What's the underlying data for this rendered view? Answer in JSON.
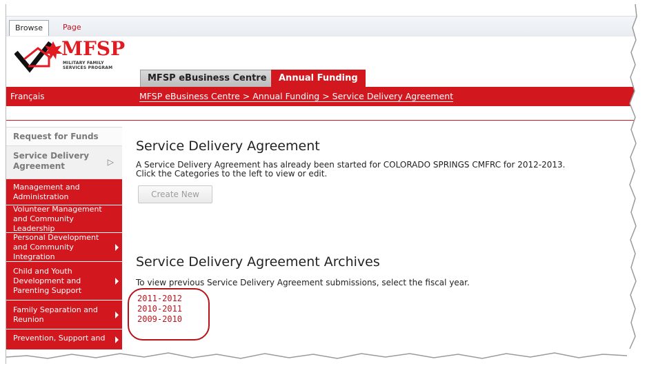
{
  "ribbon": {
    "tabs": [
      "Browse",
      "Page"
    ]
  },
  "logo": {
    "name": "MFSP",
    "subtitle_line1": "MILITARY FAMILY",
    "subtitle_line2": "SERVICES PROGRAM"
  },
  "top_tabs": [
    "MFSP eBusiness Centre",
    "Annual Funding"
  ],
  "header": {
    "language_link": "Français",
    "breadcrumb": "MFSP eBusiness Centre > Annual Funding > Service Delivery Agreement"
  },
  "sidebar": {
    "heading": "Request for Funds",
    "current": "Service Delivery Agreement",
    "items": [
      {
        "label": "Management and Administration",
        "has_arrow": false
      },
      {
        "label": "Volunteer Management and Community Leadership",
        "has_arrow": false
      },
      {
        "label": "Personal Development and Community Integration",
        "has_arrow": true
      },
      {
        "label": "Child and Youth Development and Parenting Support",
        "has_arrow": true
      },
      {
        "label": "Family Separation and Reunion",
        "has_arrow": true
      },
      {
        "label": "Prevention, Support and",
        "has_arrow": true
      }
    ]
  },
  "main": {
    "title": "Service Delivery Agreement",
    "message_line1": "A Service Delivery Agreement has already been started for COLORADO SPRINGS CMFRC for 2012-2013.",
    "message_line2": "Click the Categories to the left to view or edit.",
    "create_button": "Create New",
    "archives_title": "Service Delivery Agreement Archives",
    "archives_text": "To view previous Service Delivery Agreement submissions, select the fiscal year.",
    "years": [
      "2011-2012",
      "2010-2011",
      "2009-2010"
    ]
  },
  "colors": {
    "accent_red": "#d3171e",
    "link_red": "#c0141c"
  }
}
